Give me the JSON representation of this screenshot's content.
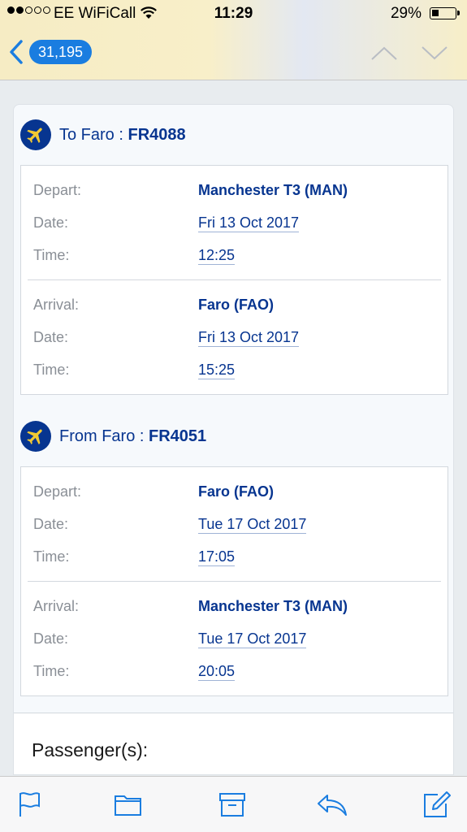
{
  "status_bar": {
    "carrier": "EE WiFiCall",
    "time": "11:29",
    "battery": "29%"
  },
  "nav": {
    "unread_count": "31,195"
  },
  "flights": [
    {
      "direction_label": "To Faro : ",
      "flight_number": "FR4088",
      "depart": {
        "place_label": "Depart:",
        "place": "Manchester T3 (MAN)",
        "date_label": "Date:",
        "date": "Fri 13 Oct 2017",
        "time_label": "Time:",
        "time": "12:25"
      },
      "arrival": {
        "place_label": "Arrival:",
        "place": "Faro (FAO)",
        "date_label": "Date:",
        "date": "Fri 13 Oct 2017",
        "time_label": "Time:",
        "time": "15:25"
      }
    },
    {
      "direction_label": "From Faro : ",
      "flight_number": "FR4051",
      "depart": {
        "place_label": "Depart:",
        "place": "Faro (FAO)",
        "date_label": "Date:",
        "date": "Tue 17 Oct 2017",
        "time_label": "Time:",
        "time": "17:05"
      },
      "arrival": {
        "place_label": "Arrival:",
        "place": "Manchester T3 (MAN)",
        "date_label": "Date:",
        "date": "Tue 17 Oct 2017",
        "time_label": "Time:",
        "time": "20:05"
      }
    }
  ],
  "passengers_title": "Passenger(s):",
  "colors": {
    "accent": "#1a7de0",
    "brand": "#073590",
    "badge_plane": "#f1c933"
  },
  "toolbar": {
    "icons": [
      "flag-icon",
      "folder-icon",
      "archive-icon",
      "reply-icon",
      "compose-icon"
    ]
  }
}
